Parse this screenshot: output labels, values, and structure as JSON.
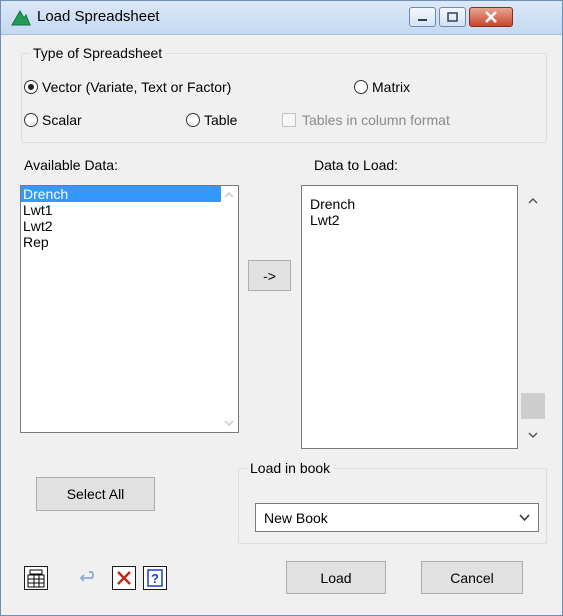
{
  "window": {
    "title": "Load Spreadsheet"
  },
  "spreadsheet_type": {
    "legend": "Type of Spreadsheet",
    "options": [
      {
        "label": "Vector (Variate, Text or Factor)",
        "selected": true
      },
      {
        "label": "Matrix",
        "selected": false
      },
      {
        "label": "Scalar",
        "selected": false
      },
      {
        "label": "Table",
        "selected": false
      }
    ],
    "tables_checkbox": {
      "label": "Tables in column format",
      "checked": false,
      "enabled": false
    }
  },
  "available": {
    "label": "Available Data:",
    "items": [
      "Drench",
      "Lwt1",
      "Lwt2",
      "Rep"
    ],
    "selected_index": 0
  },
  "move_button": {
    "label": "->"
  },
  "to_load": {
    "label": "Data to Load:",
    "items": [
      "Drench",
      "Lwt2"
    ]
  },
  "select_all_button": {
    "label": "Select All"
  },
  "load_in_book": {
    "legend": "Load in book",
    "selected": "New Book"
  },
  "toolbar": {
    "icons": [
      "spreadsheet-icon",
      "undo-icon",
      "delete-icon",
      "help-icon"
    ]
  },
  "load_button": {
    "label": "Load"
  },
  "cancel_button": {
    "label": "Cancel"
  },
  "colors": {
    "selection": "#3399ff",
    "dialog_bg": "#f0f0f0"
  }
}
